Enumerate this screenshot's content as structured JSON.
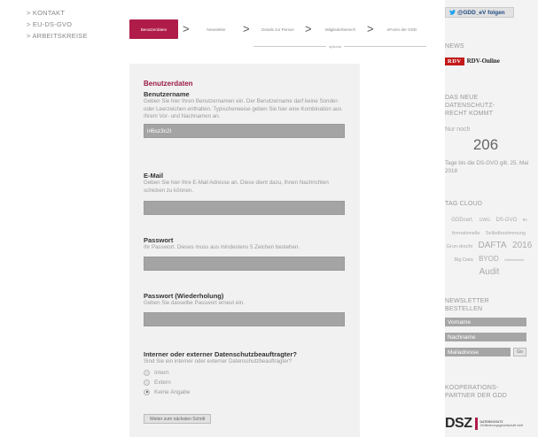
{
  "left_nav": {
    "items": [
      "> KONTAKT",
      "> EU-DS-GVO",
      "> ARBEITSKREISE"
    ]
  },
  "wizard": {
    "steps": [
      "Benutzerdaten",
      "Newsletter",
      "Details zur Person",
      "Mitgliederbereich",
      "eForen der GDD"
    ],
    "active_step": 0,
    "optional_label": "optional",
    "chevron": ">"
  },
  "form": {
    "title": "Benutzerdaten",
    "username": {
      "label": "Benutzername",
      "help": "Geben Sie hier Ihren Benutzernamen ein. Der Benutzername darf keine Sonder- oder Leerzeichen enthalten. Typischerweise geben Sie hier eine Kombination aus Ihrem Vor- und Nachnamen an.",
      "value": "irl6sz3c2l"
    },
    "email": {
      "label": "E-Mail",
      "help": "Geben Sie hier Ihre E-Mail Adresse an. Diese dient dazu, Ihnen Nachrichten schicken zu können.",
      "value": ""
    },
    "password": {
      "label": "Passwort",
      "help": "Ihr Passwort. Dieses muss aus mindestens 5 Zeichen bestehen.",
      "value": ""
    },
    "password_repeat": {
      "label": "Passwort (Wiederholung)",
      "help": "Geben Sie dasselbe Passwort erneut ein.",
      "value": ""
    },
    "dsb": {
      "label": "Interner oder externer Datenschutzbeauftragter?",
      "help": "Sind Sie ein interner oder externer Datenschutzbeauftragter?",
      "options": [
        "Intern",
        "Extern",
        "Keine Angabe"
      ],
      "selected": "Keine Angabe"
    },
    "next_button": "Weiter zum nächsten Schritt"
  },
  "sidebar": {
    "twitter_button": "@GDD_eV folgen",
    "news_heading": "NEWS",
    "rdv_logo": "RDV",
    "rdv_name": "RDV-Online",
    "countdown_heading_1": "DAS NEUE",
    "countdown_heading_2": "DATENSCHUTZ-",
    "countdown_heading_3": "RECHT KOMMT",
    "countdown_prefix": "Nur noch",
    "countdown_value": "206",
    "countdown_suffix": "Tage bis die DS-GVO gilt. 25. Mai 2018",
    "tagcloud_heading": "TAG CLOUD",
    "tags": [
      {
        "text": "GDDcert.",
        "size": 6
      },
      {
        "text": "UWG",
        "size": 5
      },
      {
        "text": "DS-GVO",
        "size": 6
      },
      {
        "text": "in-formationelle",
        "size": 5.5
      },
      {
        "text": "Selbstbestimmung",
        "size": 5.5
      },
      {
        "text": "Grun-drecht",
        "size": 5.5
      },
      {
        "text": "DAFTA",
        "size": 10
      },
      {
        "text": "2016",
        "size": 10
      },
      {
        "text": "Big Data",
        "size": 5.5
      },
      {
        "text": "BYOD",
        "size": 8
      },
      {
        "text": "Datenschutz",
        "size": 4
      },
      {
        "text": "Audit",
        "size": 10
      }
    ],
    "newsletter_heading_1": "NEWSLETTER",
    "newsletter_heading_2": "BESTELLEN",
    "newsletter_firstname": "Vorname",
    "newsletter_lastname": "Nachname",
    "newsletter_email": "Mailadresse",
    "newsletter_go": "Go",
    "partner_heading_1": "KOOPERATIONS-",
    "partner_heading_2": "PARTNER DER GDD",
    "partner_logo": "DSZ",
    "partner_text_1": "DATENSCHUTZ",
    "partner_text_2": "Zertifizierungsgesellschaft mbH"
  }
}
